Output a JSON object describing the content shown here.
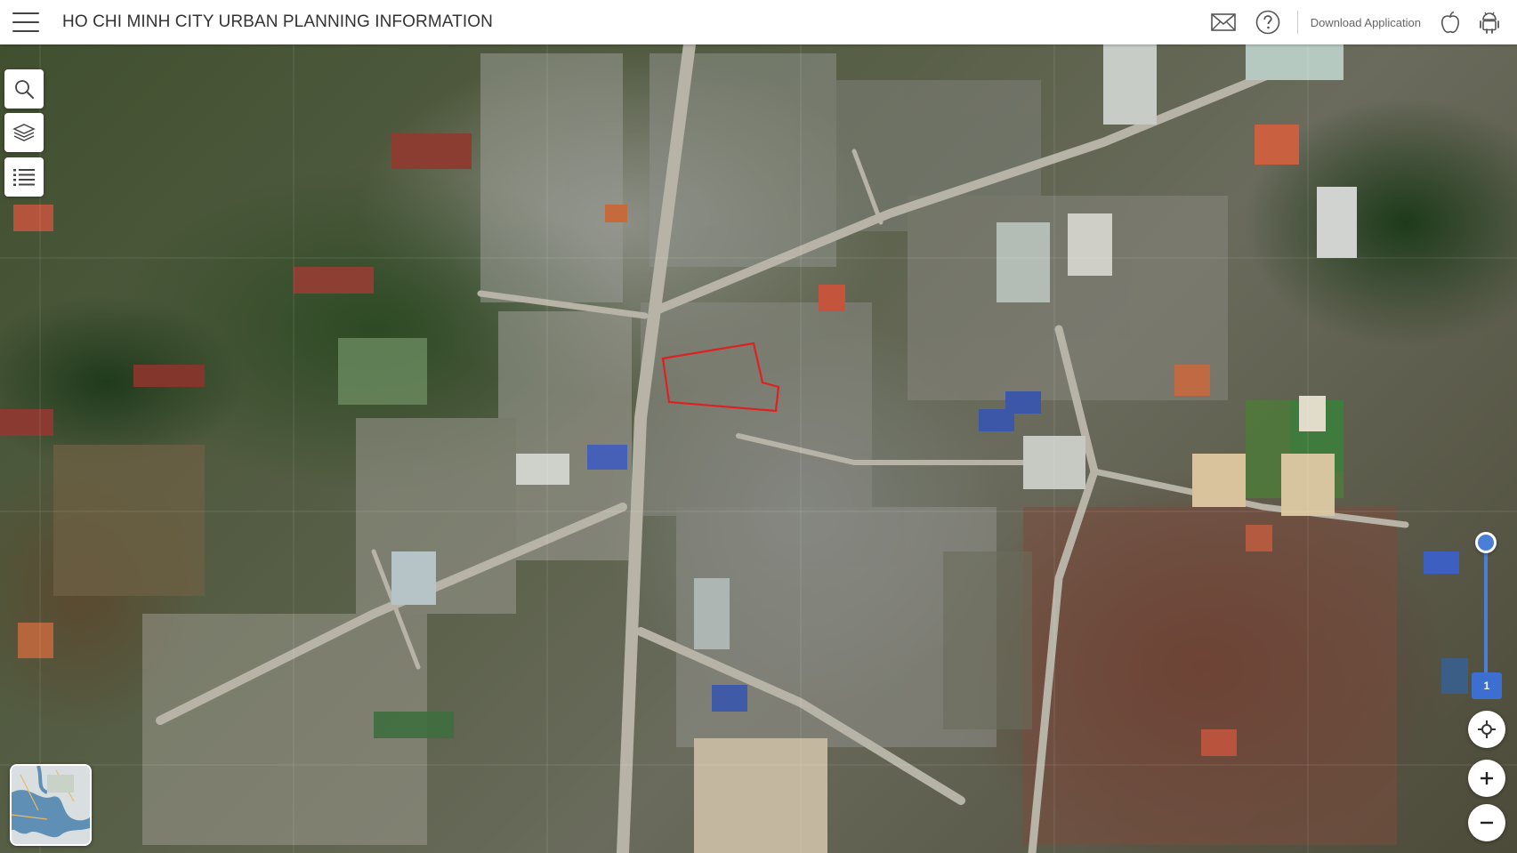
{
  "header": {
    "title": "HO CHI MINH CITY URBAN PLANNING INFORMATION",
    "download_label": "Download Application"
  },
  "icons": {
    "menu": "menu-icon",
    "mail": "mail-icon",
    "help": "help-icon",
    "apple": "apple-icon",
    "android": "android-icon",
    "search": "search-icon",
    "layers": "layers-icon",
    "list": "list-icon",
    "locate": "locate-icon",
    "zoom_in": "plus-icon",
    "zoom_out": "minus-icon"
  },
  "map": {
    "basemap": "satellite",
    "highlight_color": "#e02020",
    "opacity_slider_value": "1"
  },
  "colors": {
    "accent": "#3d6fd1",
    "header_bg": "#ffffff"
  }
}
